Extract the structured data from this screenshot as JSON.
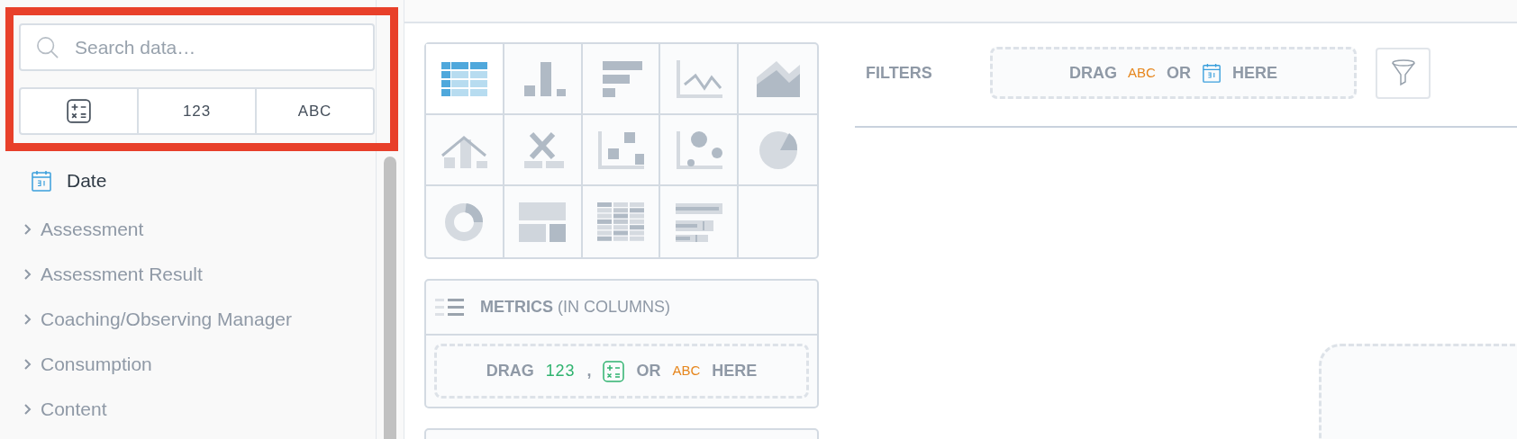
{
  "search": {
    "placeholder": "Search data…"
  },
  "type_filters": [
    {
      "kind": "calc"
    },
    {
      "kind": "text",
      "label": "123"
    },
    {
      "kind": "text",
      "label": "ABC"
    }
  ],
  "fields": [
    {
      "kind": "date",
      "label": "Date"
    },
    {
      "kind": "group",
      "label": "Assessment",
      "expanded": false
    },
    {
      "kind": "group",
      "label": "Assessment Result",
      "expanded": false
    },
    {
      "kind": "group",
      "label": "Coaching/Observing Manager",
      "expanded": false
    },
    {
      "kind": "group",
      "label": "Consumption",
      "expanded": false
    },
    {
      "kind": "group",
      "label": "Content",
      "expanded": false
    }
  ],
  "chart_types": [
    {
      "kind": "table",
      "selected": true
    },
    {
      "kind": "column",
      "selected": false
    },
    {
      "kind": "bar",
      "selected": false
    },
    {
      "kind": "line",
      "selected": false
    },
    {
      "kind": "area",
      "selected": false
    },
    {
      "kind": "combo",
      "selected": false
    },
    {
      "kind": "headline",
      "selected": false
    },
    {
      "kind": "scatter",
      "selected": false
    },
    {
      "kind": "bubble",
      "selected": false
    },
    {
      "kind": "pie",
      "selected": false
    },
    {
      "kind": "donut",
      "selected": false
    },
    {
      "kind": "treemap",
      "selected": false
    },
    {
      "kind": "heatmap",
      "selected": false
    },
    {
      "kind": "bullet",
      "selected": false
    }
  ],
  "metrics": {
    "title": "**METRICS** (IN COLUMNS)",
    "drop": [
      {
        "kind": "word",
        "text": "DRAG"
      },
      {
        "kind": "num",
        "text": "123"
      },
      {
        "kind": "word",
        "text": ","
      },
      {
        "kind": "calc"
      },
      {
        "kind": "word",
        "text": "OR"
      },
      {
        "kind": "attr",
        "text": "ABC"
      },
      {
        "kind": "word",
        "text": "HERE"
      }
    ]
  },
  "filters": {
    "label": "FILTERS",
    "drop": [
      {
        "kind": "word",
        "text": "DRAG"
      },
      {
        "kind": "attr",
        "text": "ABC"
      },
      {
        "kind": "word",
        "text": "OR"
      },
      {
        "kind": "date"
      },
      {
        "kind": "word",
        "text": "HERE"
      }
    ]
  }
}
